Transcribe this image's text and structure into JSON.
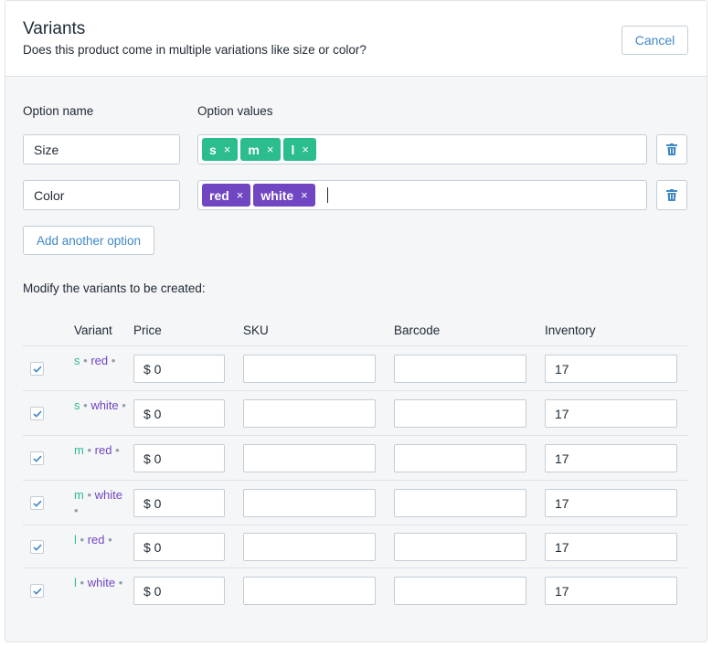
{
  "header": {
    "title": "Variants",
    "subtitle": "Does this product come in multiple variations like size or color?",
    "cancel_label": "Cancel"
  },
  "options": {
    "name_label": "Option name",
    "values_label": "Option values",
    "rows": [
      {
        "name": "Size",
        "values": [
          "s",
          "m",
          "l"
        ],
        "color": "#2cbd8f"
      },
      {
        "name": "Color",
        "values": [
          "red",
          "white"
        ],
        "color": "#7146c2"
      }
    ],
    "add_label": "Add another option"
  },
  "variants": {
    "heading": "Modify the variants to be created:",
    "columns": {
      "variant": "Variant",
      "price": "Price",
      "sku": "SKU",
      "barcode": "Barcode",
      "inventory": "Inventory"
    },
    "separator": "•",
    "rows": [
      {
        "size": "s",
        "color": "red",
        "price": "$ 0",
        "sku": "",
        "barcode": "",
        "inventory": "17",
        "checked": true
      },
      {
        "size": "s",
        "color": "white",
        "price": "$ 0",
        "sku": "",
        "barcode": "",
        "inventory": "17",
        "checked": true
      },
      {
        "size": "m",
        "color": "red",
        "price": "$ 0",
        "sku": "",
        "barcode": "",
        "inventory": "17",
        "checked": true
      },
      {
        "size": "m",
        "color": "white",
        "price": "$ 0",
        "sku": "",
        "barcode": "",
        "inventory": "17",
        "checked": true
      },
      {
        "size": "l",
        "color": "red",
        "price": "$ 0",
        "sku": "",
        "barcode": "",
        "inventory": "17",
        "checked": true
      },
      {
        "size": "l",
        "color": "white",
        "price": "$ 0",
        "sku": "",
        "barcode": "",
        "inventory": "17",
        "checked": true
      }
    ]
  },
  "icons": {
    "tag_remove": "×",
    "delete": "trash-icon",
    "checkbox": "checkmark-icon"
  },
  "colors": {
    "accent": "#3f88c5",
    "size_tag": "#2cbd8f",
    "color_tag": "#7146c2"
  }
}
